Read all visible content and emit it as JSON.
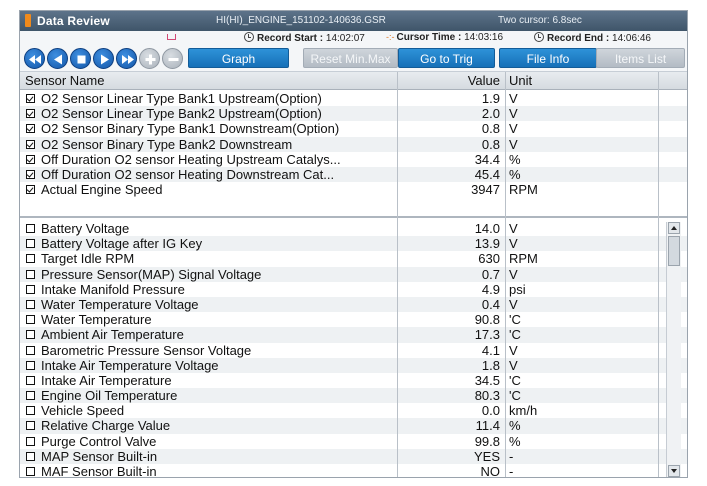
{
  "title_bar": {
    "title": "Data Review",
    "file": "HI(HI)_ENGINE_151102-140636.GSR",
    "cursor_mode": "Two cursor: 6.8sec"
  },
  "record_info": {
    "start_label": "Record Start :",
    "start_time": "14:02:07",
    "cursor_label": "Cursor Time :",
    "cursor_time": "14:03:16",
    "end_label": "Record End :",
    "end_time": "14:06:46"
  },
  "toolbar": {
    "graph": "Graph",
    "reset_minmax": "Reset Min.Max",
    "go_to_trig": "Go to Trig",
    "file_info": "File Info",
    "items_list": "Items List"
  },
  "columns": {
    "name": "Sensor Name",
    "value": "Value",
    "unit": "Unit"
  },
  "selected": [
    {
      "name": "O2 Sensor Linear Type Bank1 Upstream(Option)",
      "value": "1.9",
      "unit": "V",
      "checked": true
    },
    {
      "name": "O2 Sensor Linear Type Bank2 Upstream(Option)",
      "value": "2.0",
      "unit": "V",
      "checked": true
    },
    {
      "name": "O2 Sensor Binary Type Bank1 Downstream(Option)",
      "value": "0.8",
      "unit": "V",
      "checked": true
    },
    {
      "name": "O2 Sensor Binary Type Bank2 Downstream",
      "value": "0.8",
      "unit": "V",
      "checked": true
    },
    {
      "name": "Off Duration O2 sensor Heating Upstream Catalys...",
      "value": "34.4",
      "unit": "%",
      "checked": true
    },
    {
      "name": "Off Duration O2 sensor Heating Downstream Cat...",
      "value": "45.4",
      "unit": "%",
      "checked": true
    },
    {
      "name": "Actual Engine Speed",
      "value": "3947",
      "unit": "RPM",
      "checked": true
    }
  ],
  "sensors": [
    {
      "name": "Battery Voltage",
      "value": "14.0",
      "unit": "V",
      "checked": false
    },
    {
      "name": "Battery Voltage after IG Key",
      "value": "13.9",
      "unit": "V",
      "checked": false
    },
    {
      "name": "Target Idle RPM",
      "value": "630",
      "unit": "RPM",
      "checked": false
    },
    {
      "name": "Pressure Sensor(MAP) Signal Voltage",
      "value": "0.7",
      "unit": "V",
      "checked": false
    },
    {
      "name": "Intake Manifold Pressure",
      "value": "4.9",
      "unit": "psi",
      "checked": false
    },
    {
      "name": "Water Temperature Voltage",
      "value": "0.4",
      "unit": "V",
      "checked": false
    },
    {
      "name": "Water Temperature",
      "value": "90.8",
      "unit": "'C",
      "checked": false
    },
    {
      "name": "Ambient Air Temperature",
      "value": "17.3",
      "unit": "'C",
      "checked": false
    },
    {
      "name": "Barometric Pressure Sensor Voltage",
      "value": "4.1",
      "unit": "V",
      "checked": false
    },
    {
      "name": "Intake Air Temperature Voltage",
      "value": "1.8",
      "unit": "V",
      "checked": false
    },
    {
      "name": "Intake Air Temperature",
      "value": "34.5",
      "unit": "'C",
      "checked": false
    },
    {
      "name": "Engine Oil Temperature",
      "value": "80.3",
      "unit": "'C",
      "checked": false
    },
    {
      "name": "Vehicle Speed",
      "value": "0.0",
      "unit": "km/h",
      "checked": false
    },
    {
      "name": "Relative Charge Value",
      "value": "11.4",
      "unit": "%",
      "checked": false
    },
    {
      "name": "Purge Control Valve",
      "value": "99.8",
      "unit": "%",
      "checked": false
    },
    {
      "name": "MAP Sensor Built-in",
      "value": "YES",
      "unit": "-",
      "checked": false
    },
    {
      "name": "MAF Sensor Built-in",
      "value": "NO",
      "unit": "-",
      "checked": false
    }
  ],
  "colors": {
    "title_bar": "#4b6278",
    "accent_blue": "#1670b8",
    "row_alt": "#eef1f3"
  }
}
